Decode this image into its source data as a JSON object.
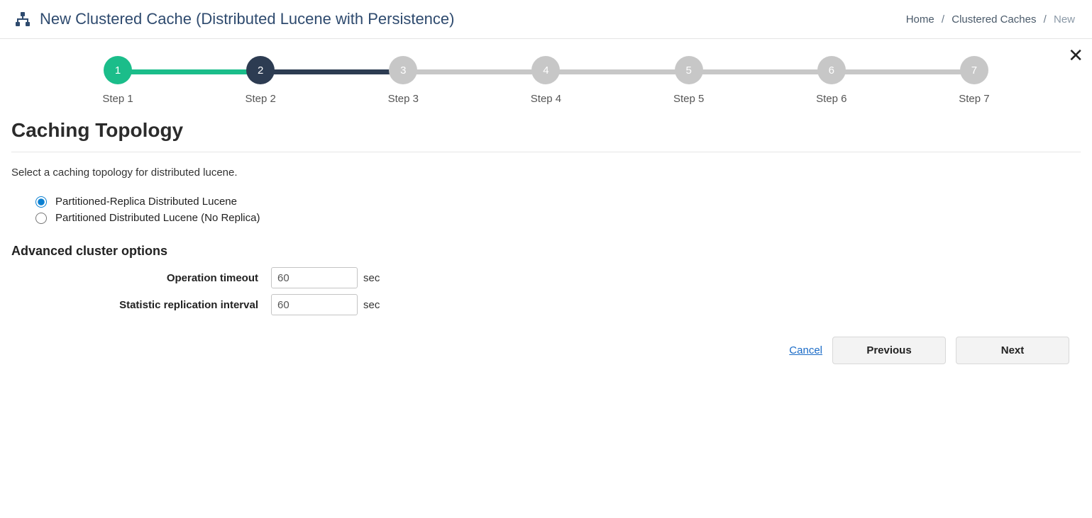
{
  "header": {
    "title": "New Clustered Cache (Distributed Lucene with Persistence)"
  },
  "breadcrumb": {
    "items": [
      {
        "label": "Home"
      },
      {
        "label": "Clustered Caches"
      },
      {
        "label": "New"
      }
    ]
  },
  "close_icon": "✕",
  "stepper": {
    "steps": [
      {
        "num": "1",
        "label": "Step 1",
        "state": "done",
        "color": "#1bbd8a"
      },
      {
        "num": "2",
        "label": "Step 2",
        "state": "active",
        "color": "#2d3c52"
      },
      {
        "num": "3",
        "label": "Step 3",
        "state": "pending",
        "color": "#c7c7c7"
      },
      {
        "num": "4",
        "label": "Step 4",
        "state": "pending",
        "color": "#c7c7c7"
      },
      {
        "num": "5",
        "label": "Step 5",
        "state": "pending",
        "color": "#c7c7c7"
      },
      {
        "num": "6",
        "label": "Step 6",
        "state": "pending",
        "color": "#c7c7c7"
      },
      {
        "num": "7",
        "label": "Step 7",
        "state": "pending",
        "color": "#c7c7c7"
      }
    ],
    "segments": [
      {
        "from": 0,
        "to": 1,
        "color": "#1bbd8a"
      },
      {
        "from": 1,
        "to": 2,
        "color": "#2d3c52"
      }
    ]
  },
  "section": {
    "title": "Caching Topology",
    "description": "Select a caching topology for distributed lucene."
  },
  "topology_options": [
    {
      "label": "Partitioned-Replica Distributed Lucene",
      "checked": true
    },
    {
      "label": "Partitioned Distributed Lucene (No Replica)",
      "checked": false
    }
  ],
  "advanced": {
    "heading": "Advanced cluster options",
    "fields": [
      {
        "label": "Operation timeout",
        "value": "60",
        "unit": "sec"
      },
      {
        "label": "Statistic replication interval",
        "value": "60",
        "unit": "sec"
      }
    ]
  },
  "footer": {
    "cancel": "Cancel",
    "previous": "Previous",
    "next": "Next"
  }
}
